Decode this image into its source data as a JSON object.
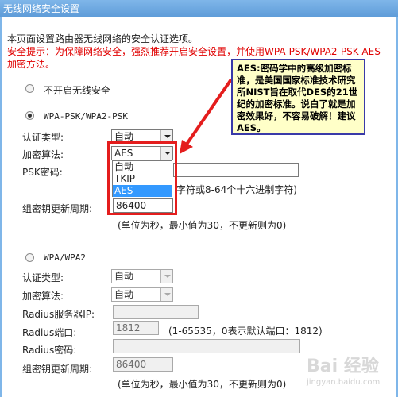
{
  "window": {
    "title": "无线网络安全设置"
  },
  "intro": {
    "description": "本页面设置路由器无线网络的安全认证选项。",
    "warning_line1": "安全提示：为保障网络安全，强烈推荐开启安全设置，并使用WPA-PSK/WPA2-PSK AES",
    "warning_line2": "加密方法。"
  },
  "option_none": {
    "label": "不开启无线安全",
    "selected": false
  },
  "wpa_psk": {
    "label": "WPA-PSK/WPA2-PSK",
    "selected": true,
    "auth_type_label": "认证类型:",
    "auth_type_value": "自动",
    "cipher_label": "加密算法:",
    "cipher_value": "AES",
    "cipher_options": [
      "自动",
      "TKIP",
      "AES"
    ],
    "cipher_highlighted": "AES",
    "psk_label": "PSK密码:",
    "psk_value": "",
    "psk_hint": "字符或8-64个十六进制字符)",
    "group_key_label": "组密钥更新周期:",
    "group_key_value": "86400",
    "group_key_hint": "(单位为秒，最小值为30，不更新则为0)"
  },
  "wpa": {
    "label": "WPA/WPA2",
    "selected": false,
    "auth_type_label": "认证类型:",
    "auth_type_value": "自动",
    "cipher_label": "加密算法:",
    "cipher_value": "自动",
    "radius_ip_label": "Radius服务器IP:",
    "radius_ip_value": "",
    "radius_port_label": "Radius端口:",
    "radius_port_value": "1812",
    "radius_port_hint": "(1-65535，0表示默认端口：1812)",
    "radius_pwd_label": "Radius密码:",
    "radius_pwd_value": "",
    "group_key_label": "组密钥更新周期:",
    "group_key_value": "86400",
    "group_key_hint": "(单位为秒，最小值为30，不更新则为0)"
  },
  "annotation": {
    "text": "AES:密码学中的高级加密标准，是美国国家标准技术研究所NIST旨在取代DES的21世纪的加密标准。说白了就是加密效果好，不容易破解！建议AES。"
  },
  "watermark": {
    "text": "Bai 经验",
    "sub": "jingyan.baidu.com"
  },
  "colors": {
    "titlebar": "#6aa6e0",
    "warning": "#e00000",
    "highlight_box": "#e41d1d",
    "callout_bg": "#ffffc8"
  }
}
